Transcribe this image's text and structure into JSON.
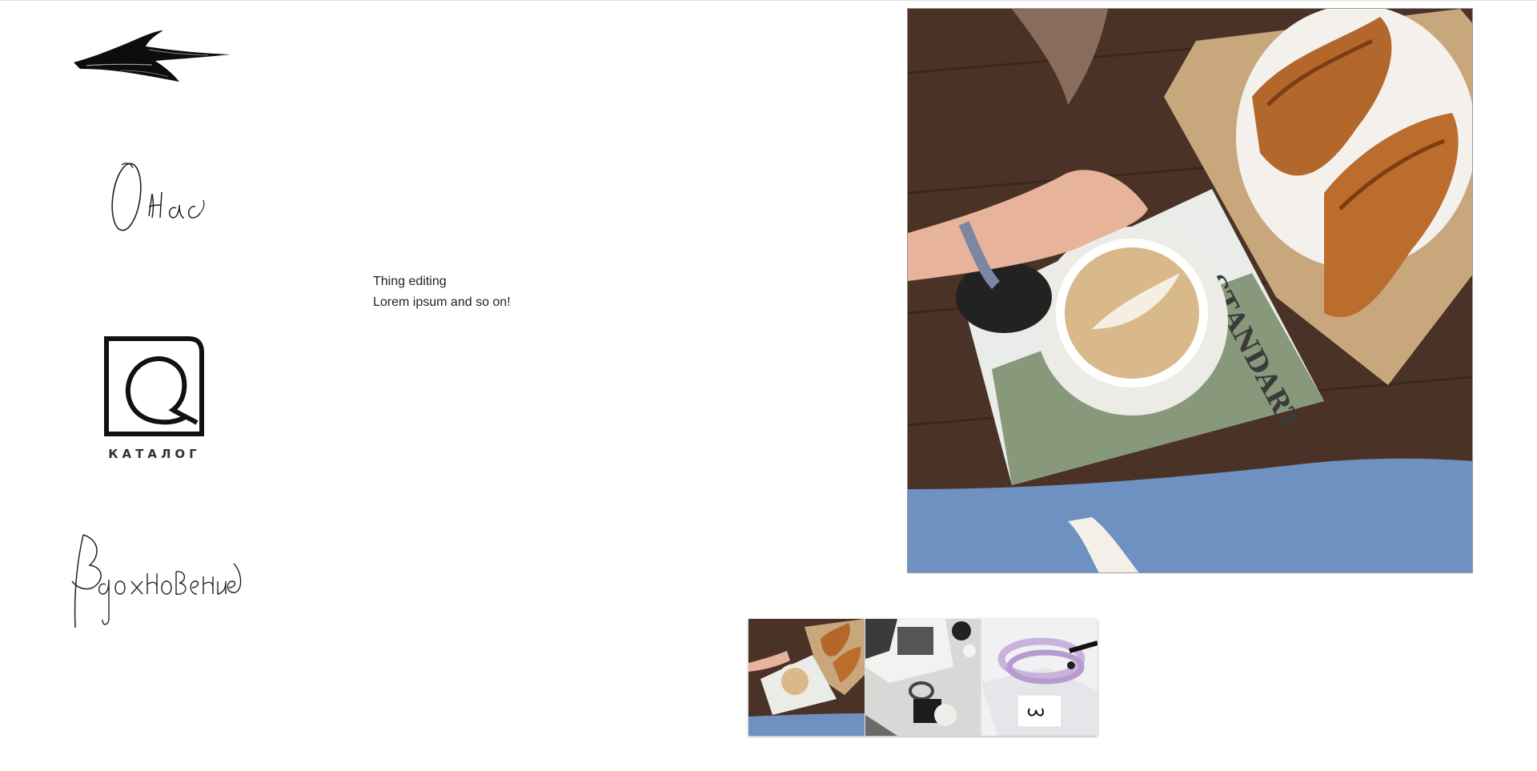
{
  "nav": {
    "back": {
      "icon": "brush-arrow-left-icon"
    },
    "about": {
      "label": "О нас"
    },
    "catalog": {
      "icon": "catalog-logo-icon",
      "label": "КАТАЛОГ"
    },
    "inspiration": {
      "label": "Вдохновение"
    }
  },
  "content": {
    "title": "Thing editing",
    "body": "Lorem ipsum and so on!"
  },
  "gallery": {
    "main_image": "coffee-croissant-photo",
    "thumbnails": [
      {
        "image": "coffee-croissant-thumb"
      },
      {
        "image": "book-bracelets-thumb"
      },
      {
        "image": "pink-bracelet-thumb"
      }
    ]
  },
  "colors": {
    "background": "#ffffff",
    "ink": "#111111",
    "text": "#222222"
  }
}
